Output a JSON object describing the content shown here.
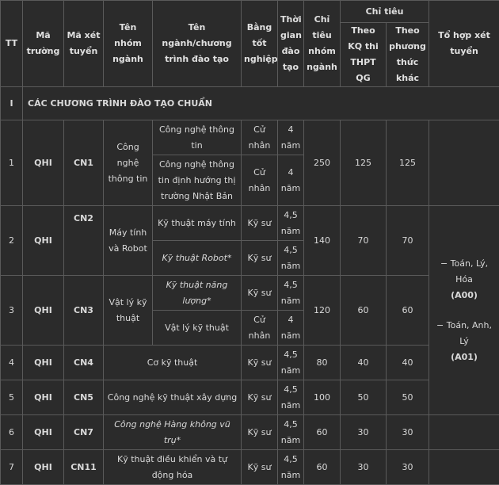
{
  "header": {
    "tt": "TT",
    "ma_truong": "Mã trường",
    "ma_xet_tuyen": "Mã xét tuyển",
    "ten_nhom_nganh": "Tên nhóm ngành",
    "ten_nganh": "Tên ngành/chương trình đào tạo",
    "bang_tot_nghiep": "Bằng tốt nghiệp",
    "thoi_gian": "Thời gian đào tạo",
    "chi_tieu_nhom": "Chỉ tiêu nhóm ngành",
    "chi_tieu": "Chỉ tiêu",
    "theo_kq": "Theo KQ thi THPT QG",
    "theo_pt": "Theo phương thức khác",
    "to_hop": "Tổ hợp xét tuyển"
  },
  "section": {
    "num": "I",
    "title": "CÁC CHƯƠNG TRÌNH ĐÀO TẠO CHUẨN"
  },
  "rows": [
    {
      "tt": "1",
      "truong": "QHI",
      "ma": "CN1",
      "nhom": "Công nghệ thông tin",
      "chi_tieu_nhom": "250",
      "kq": "125",
      "khac": "125",
      "programs": [
        {
          "name": "Công nghệ thông tin",
          "degree": "Cử nhân",
          "years": "4 năm"
        },
        {
          "name": "Công nghệ thông tin định hướng thị trường Nhật Bản",
          "degree": "Cử nhân",
          "years": "4 năm"
        }
      ]
    },
    {
      "tt": "2",
      "truong": "QHI",
      "ma": "CN2",
      "nhom": "Máy tính và Robot",
      "chi_tieu_nhom": "140",
      "kq": "70",
      "khac": "70",
      "programs": [
        {
          "name": "Kỹ thuật máy tính",
          "degree": "Kỹ sư",
          "years": "4,5 năm"
        },
        {
          "name": "Kỹ thuật Robot*",
          "degree": "Kỹ sư",
          "years": "4,5 năm"
        }
      ]
    },
    {
      "tt": "3",
      "truong": "QHI",
      "ma": "CN3",
      "nhom": "Vật lý kỹ thuật",
      "chi_tieu_nhom": "120",
      "kq": "60",
      "khac": "60",
      "programs": [
        {
          "name": "Kỹ thuật năng lượng*",
          "degree": "Kỹ sư",
          "years": "4,5 năm"
        },
        {
          "name": "Vật lý kỹ thuật",
          "degree": "Cử nhân",
          "years": "4 năm"
        }
      ]
    },
    {
      "tt": "4",
      "truong": "QHI",
      "ma": "CN4",
      "name": "Cơ kỹ thuật",
      "degree": "Kỹ sư",
      "years": "4,5 năm",
      "chi_tieu_nhom": "80",
      "kq": "40",
      "khac": "40"
    },
    {
      "tt": "5",
      "truong": "QHI",
      "ma": "CN5",
      "name": "Công nghệ kỹ thuật xây dựng",
      "degree": "Kỹ sư",
      "years": "4,5 năm",
      "chi_tieu_nhom": "100",
      "kq": "50",
      "khac": "50"
    },
    {
      "tt": "6",
      "truong": "QHI",
      "ma": "CN7",
      "name": "Công nghệ Hàng không vũ trụ*",
      "degree": "Kỹ sư",
      "years": "4,5 năm",
      "chi_tieu_nhom": "60",
      "kq": "30",
      "khac": "30"
    },
    {
      "tt": "7",
      "truong": "QHI",
      "ma": "CN11",
      "name": "Kỹ thuật điều khiển và tự động hóa",
      "degree": "Kỹ sư",
      "years": "4,5 năm",
      "chi_tieu_nhom": "60",
      "kq": "30",
      "khac": "30"
    }
  ],
  "to_hop": {
    "line1": "− Toán, Lý, Hóa",
    "code1": "(A00)",
    "line2": "− Toán, Anh, Lý",
    "code2": "(A01)"
  }
}
